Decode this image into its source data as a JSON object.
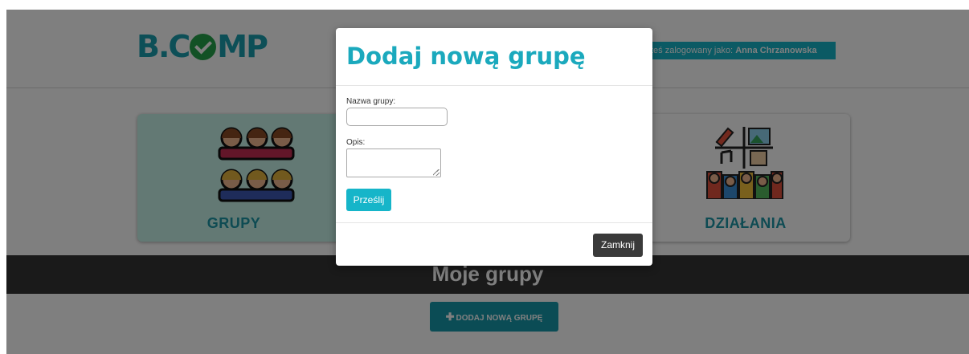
{
  "header": {
    "logo_text_left": "B.C",
    "logo_text_right": "MP",
    "user_prefix": "teś zalogowany jako:",
    "user_name": "Anna Chrzanowska"
  },
  "tiles": {
    "groups_label": "GRUPY",
    "actions_label": "DZIAŁANIA"
  },
  "section": {
    "title": "Moje grupy",
    "add_button_label": "DODAJ NOWĄ GRUPĘ",
    "add_button_icon": "plus-icon"
  },
  "modal": {
    "title": "Dodaj nową grupę",
    "name_label": "Nazwa grupy:",
    "name_value": "",
    "desc_label": "Opis:",
    "desc_value": "",
    "submit_label": "Prześlij",
    "close_label": "Zamknij"
  },
  "colors": {
    "brand": "#1b9eaf",
    "accent": "#16b5c9",
    "check": "#25a34a",
    "groups_tile": "#c6f3e8",
    "section_bar": "#353535"
  }
}
